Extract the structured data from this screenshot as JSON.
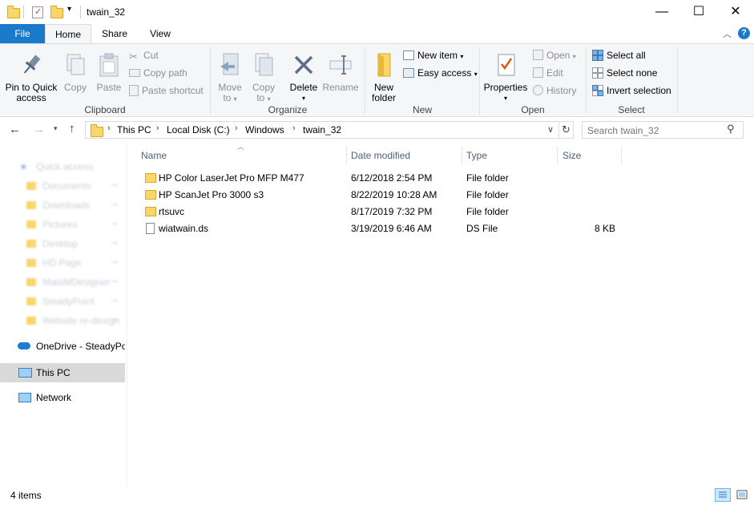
{
  "window": {
    "title": "twain_32"
  },
  "tabs": [
    {
      "label": "File"
    },
    {
      "label": "Home"
    },
    {
      "label": "Share"
    },
    {
      "label": "View"
    }
  ],
  "ribbon": {
    "clipboard": {
      "pin_label_1": "Pin to Quick",
      "pin_label_2": "access",
      "copy": "Copy",
      "paste": "Paste",
      "cut": "Cut",
      "copy_path": "Copy path",
      "paste_shortcut": "Paste shortcut",
      "group": "Clipboard"
    },
    "organize": {
      "move_to_1": "Move",
      "move_to_2": "to",
      "copy_to_1": "Copy",
      "copy_to_2": "to",
      "delete": "Delete",
      "rename": "Rename",
      "group": "Organize"
    },
    "new": {
      "new_folder_1": "New",
      "new_folder_2": "folder",
      "new_item": "New item",
      "easy_access": "Easy access",
      "group": "New"
    },
    "open": {
      "properties": "Properties",
      "open": "Open",
      "edit": "Edit",
      "history": "History",
      "group": "Open"
    },
    "select": {
      "select_all": "Select all",
      "select_none": "Select none",
      "invert": "Invert selection",
      "group": "Select"
    }
  },
  "address": {
    "crumbs": [
      "This PC",
      "Local Disk (C:)",
      "Windows",
      "twain_32"
    ],
    "search_placeholder": "Search twain_32"
  },
  "navpane": {
    "quick_access": "Quick access",
    "pinned": [
      "Documents",
      "Downloads",
      "Pictures",
      "Desktop",
      "HD Page",
      "MalaMDesigner",
      "SteadyPoint",
      "Website re-design"
    ],
    "onedrive": "OneDrive - SteadyPoi",
    "this_pc": "This PC",
    "network": "Network"
  },
  "columns": {
    "name": "Name",
    "date": "Date modified",
    "type": "Type",
    "size": "Size"
  },
  "files": [
    {
      "name": "HP Color LaserJet Pro MFP M477",
      "date": "6/12/2018 2:54 PM",
      "type": "File folder",
      "size": "",
      "icon": "folder-icon"
    },
    {
      "name": "HP ScanJet Pro 3000 s3",
      "date": "8/22/2019 10:28 AM",
      "type": "File folder",
      "size": "",
      "icon": "folder-icon"
    },
    {
      "name": "rtsuvc",
      "date": "8/17/2019 7:32 PM",
      "type": "File folder",
      "size": "",
      "icon": "folder-icon"
    },
    {
      "name": "wiatwain.ds",
      "date": "3/19/2019 6:46 AM",
      "type": "DS File",
      "size": "8 KB",
      "icon": "file-icon"
    }
  ],
  "status": {
    "count": "4 items"
  },
  "colors": {
    "accent": "#1979ca",
    "selected": "#cce8ff",
    "folder": "#f8d66a"
  }
}
